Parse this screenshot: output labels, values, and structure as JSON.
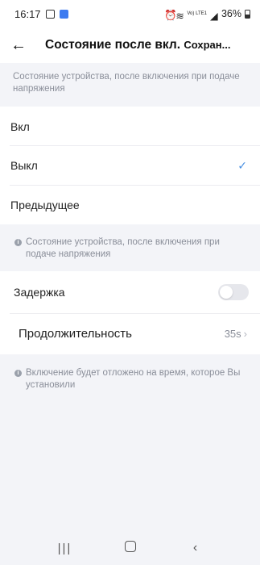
{
  "status_bar": {
    "time": "16:17",
    "battery_percent": "36%",
    "network_label": "Vo) LTE1"
  },
  "header": {
    "title": "Состояние после вкл.",
    "save_label": "Сохран..."
  },
  "section_power_on": {
    "note": "Состояние устройства, после включения при подаче напряжения",
    "options": [
      {
        "label": "Вкл",
        "selected": false
      },
      {
        "label": "Выкл",
        "selected": true
      },
      {
        "label": "Предыдущее",
        "selected": false
      }
    ]
  },
  "note_power_state": "Состояние устройства, после включения при подаче напряжения",
  "section_delay": {
    "delay_label": "Задержка",
    "delay_enabled": false,
    "duration_label": "Продолжительность",
    "duration_value": "35s"
  },
  "note_delay": "Включение будет отложено на время, которое Вы установили",
  "colors": {
    "accent": "#4a90e2",
    "background": "#f3f4f8",
    "note_text": "#8a8e99"
  }
}
